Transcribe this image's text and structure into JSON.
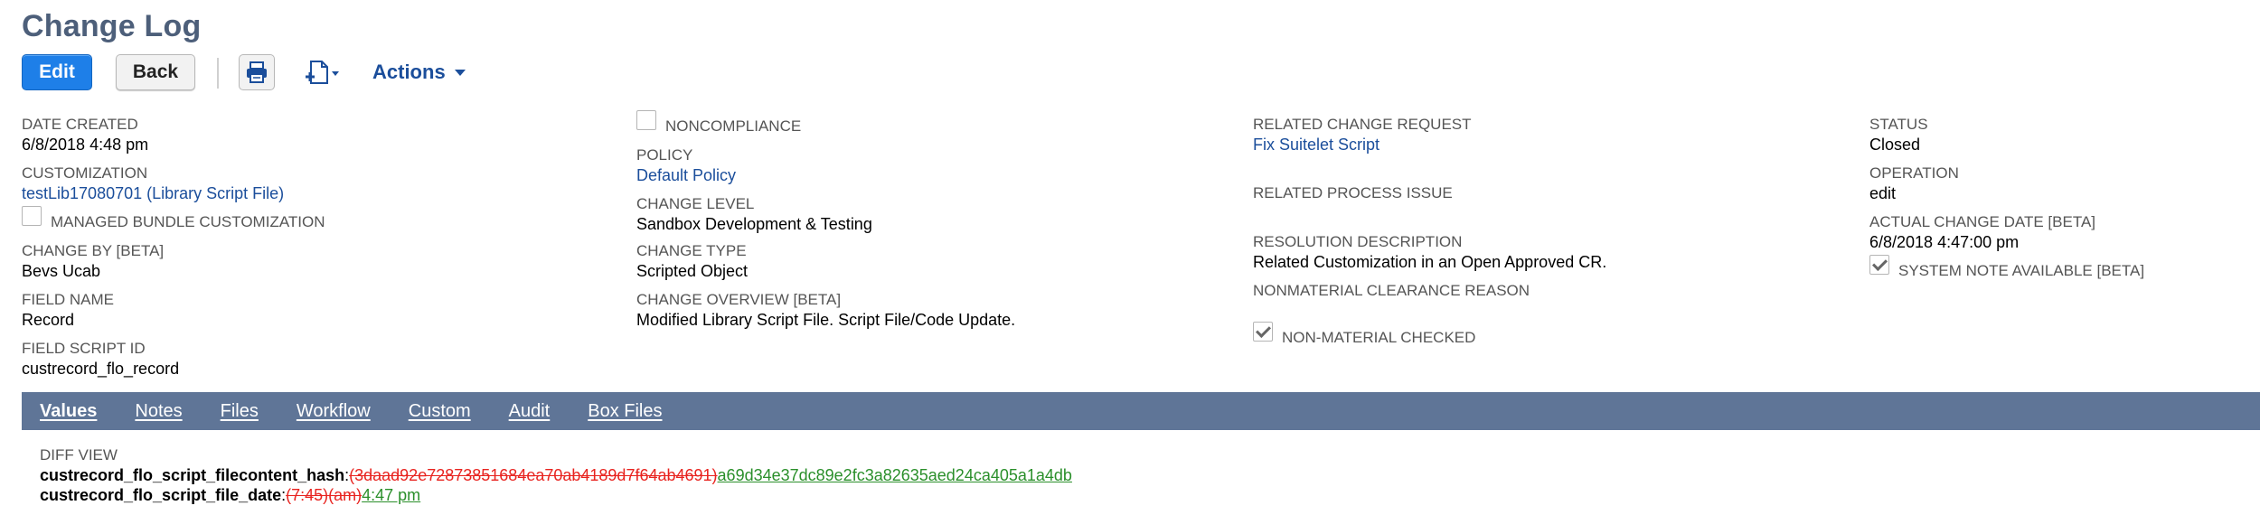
{
  "page": {
    "title": "Change Log"
  },
  "toolbar": {
    "edit_label": "Edit",
    "back_label": "Back",
    "actions_label": "Actions",
    "print_icon": "print-icon",
    "new_doc_icon": "new-document-icon"
  },
  "fields": {
    "date_created": {
      "label": "DATE CREATED",
      "value": "6/8/2018 4:48 pm"
    },
    "customization": {
      "label": "CUSTOMIZATION",
      "value": "testLib17080701 (Library Script File)"
    },
    "managed_bundle": {
      "label": "MANAGED BUNDLE CUSTOMIZATION",
      "checked": false
    },
    "change_by": {
      "label": "CHANGE BY [BETA]",
      "value": "Bevs Ucab"
    },
    "field_name": {
      "label": "FIELD NAME",
      "value": "Record"
    },
    "field_script_id": {
      "label": "FIELD SCRIPT ID",
      "value": "custrecord_flo_record"
    },
    "noncompliance": {
      "label": "NONCOMPLIANCE",
      "checked": false
    },
    "policy": {
      "label": "POLICY",
      "value": "Default Policy"
    },
    "change_level": {
      "label": "CHANGE LEVEL",
      "value": "Sandbox Development & Testing"
    },
    "change_type": {
      "label": "CHANGE TYPE",
      "value": "Scripted Object"
    },
    "change_overview": {
      "label": "CHANGE OVERVIEW [BETA]",
      "value": "Modified Library Script File. Script File/Code Update."
    },
    "related_change_request": {
      "label": "RELATED CHANGE REQUEST",
      "value": "Fix Suitelet Script"
    },
    "related_process_issue": {
      "label": "RELATED PROCESS ISSUE",
      "value": ""
    },
    "resolution_description": {
      "label": "RESOLUTION DESCRIPTION",
      "value": "Related Customization in an Open Approved CR."
    },
    "nonmaterial_clearance_reason": {
      "label": "NONMATERIAL CLEARANCE REASON",
      "value": ""
    },
    "non_material_checked": {
      "label": "NON-MATERIAL CHECKED",
      "checked": true
    },
    "status": {
      "label": "STATUS",
      "value": "Closed"
    },
    "operation": {
      "label": "OPERATION",
      "value": "edit"
    },
    "actual_change_date": {
      "label": "ACTUAL CHANGE DATE [BETA]",
      "value": "6/8/2018 4:47:00 pm"
    },
    "system_note_available": {
      "label": "SYSTEM NOTE AVAILABLE [BETA]",
      "checked": true
    }
  },
  "tabs": [
    {
      "label": "Values",
      "active": true
    },
    {
      "label": "Notes",
      "active": false
    },
    {
      "label": "Files",
      "active": false
    },
    {
      "label": "Workflow",
      "active": false
    },
    {
      "label": "Custom",
      "active": false
    },
    {
      "label": "Audit",
      "active": false
    },
    {
      "label": "Box Files",
      "active": false
    }
  ],
  "diff": {
    "title": "DIFF VIEW",
    "lines": [
      {
        "field": "custrecord_flo_script_filecontent_hash",
        "sep": ":",
        "old": "(3daad92e72873851684ea70ab4189d7f64ab4691)",
        "new": "a69d34e37dc89e2fc3a82635aed24ca405a1a4db"
      },
      {
        "field": "custrecord_flo_script_file_date",
        "sep": ":",
        "old": "(7:45)(am)",
        "new": "4:47 pm"
      }
    ]
  },
  "colors": {
    "title": "#4d5f7a",
    "link": "#1b4e9b",
    "tab_bar": "#5f7597",
    "edit_button": "#1e7fe8",
    "diff_removed": "#e8231f",
    "diff_added": "#2a8f2a"
  }
}
